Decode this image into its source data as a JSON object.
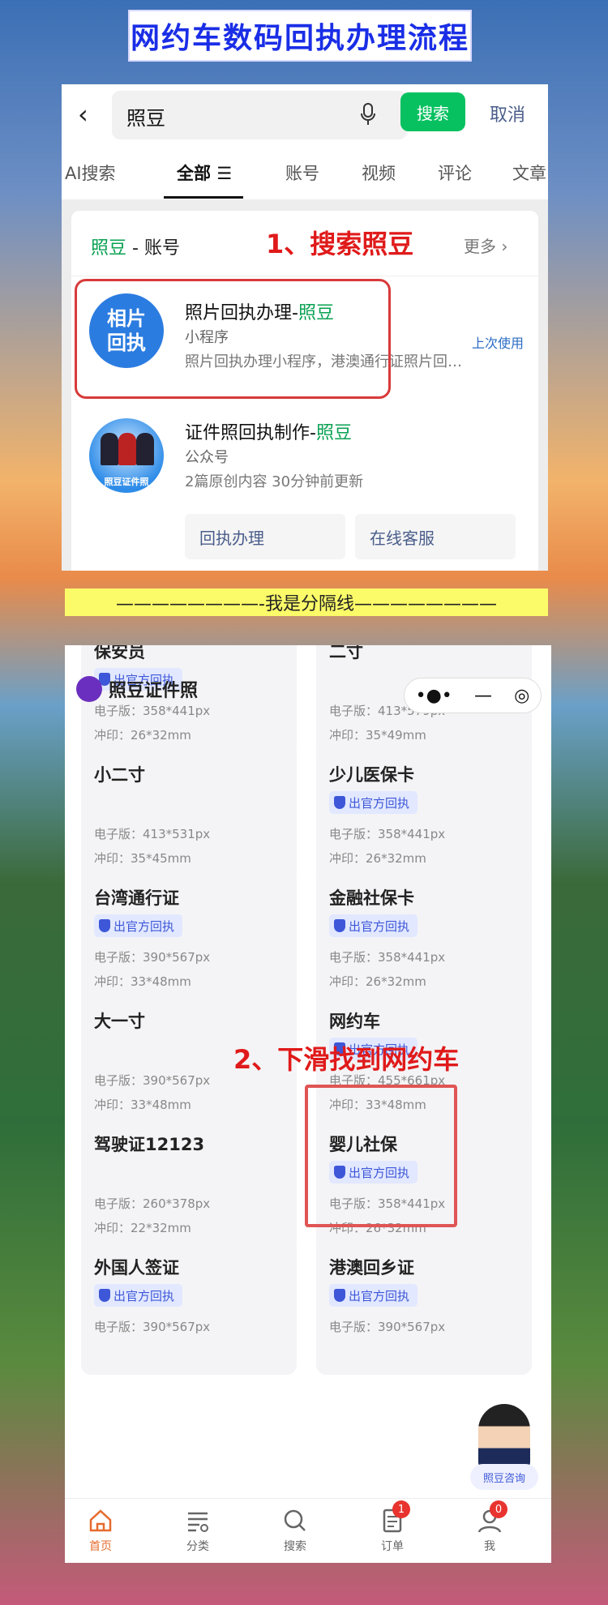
{
  "title": "网约车数码回执办理流程",
  "search": {
    "query": "照豆",
    "search_button": "搜索",
    "cancel": "取消",
    "tabs": [
      "AI搜索",
      "全部",
      "账号",
      "视频",
      "评论",
      "文章"
    ],
    "card_head_brand": "照豆",
    "card_head_suffix": " - 账号",
    "more": "更多",
    "step_note": "1、搜索照豆",
    "result1": {
      "logo_line1": "相片",
      "logo_line2": "回执",
      "title_prefix": "照片回执办理-",
      "title_brand": "照豆",
      "type": "小程序",
      "desc": "照片回执办理小程序，港澳通行证照片回…",
      "last_used": "上次使用"
    },
    "result2": {
      "logo_caption": "照豆证件照",
      "title_prefix": "证件照回执制作-",
      "title_brand": "照豆",
      "type": "公众号",
      "meta": "2篇原创内容  30分钟前更新",
      "btn1": "回执办理",
      "btn2": "在线客服"
    }
  },
  "separator": "————————-我是分隔线————————",
  "app": {
    "name": "照豆证件照",
    "capsule_more": "•●•",
    "capsule_min": "—",
    "capsule_close": "◎",
    "step_note": "2、下滑找到网约车",
    "badge_text": "出官方回执",
    "cards": [
      {
        "name": "保安员",
        "badge": true,
        "e": "电子版：358*441px",
        "p": "冲印：26*32mm"
      },
      {
        "name": "二寸",
        "badge": false,
        "e": "电子版：413*579px",
        "p": "冲印：35*49mm"
      },
      {
        "name": "小二寸",
        "badge": false,
        "e": "电子版：413*531px",
        "p": "冲印：35*45mm"
      },
      {
        "name": "少儿医保卡",
        "badge": true,
        "e": "电子版：358*441px",
        "p": "冲印：26*32mm"
      },
      {
        "name": "台湾通行证",
        "badge": true,
        "e": "电子版：390*567px",
        "p": "冲印：33*48mm"
      },
      {
        "name": "金融社保卡",
        "badge": true,
        "e": "电子版：358*441px",
        "p": "冲印：26*32mm"
      },
      {
        "name": "大一寸",
        "badge": false,
        "e": "电子版：390*567px",
        "p": "冲印：33*48mm"
      },
      {
        "name": "网约车",
        "badge": true,
        "e": "电子版：455*661px",
        "p": "冲印：33*48mm"
      },
      {
        "name": "驾驶证12123",
        "badge": false,
        "e": "电子版：260*378px",
        "p": "冲印：22*32mm"
      },
      {
        "name": "婴儿社保",
        "badge": true,
        "e": "电子版：358*441px",
        "p": "冲印：26*32mm"
      },
      {
        "name": "外国人签证",
        "badge": true,
        "e": "电子版：390*567px",
        "p": ""
      },
      {
        "name": "港澳回乡证",
        "badge": true,
        "e": "电子版：390*567px",
        "p": ""
      }
    ],
    "consult": "照豆咨询",
    "tabbar": [
      {
        "label": "首页",
        "icon": "home-icon"
      },
      {
        "label": "分类",
        "icon": "category-icon"
      },
      {
        "label": "搜索",
        "icon": "search-icon"
      },
      {
        "label": "订单",
        "icon": "order-icon",
        "badge": "1"
      },
      {
        "label": "我",
        "icon": "user-icon",
        "badge": "0"
      }
    ]
  }
}
